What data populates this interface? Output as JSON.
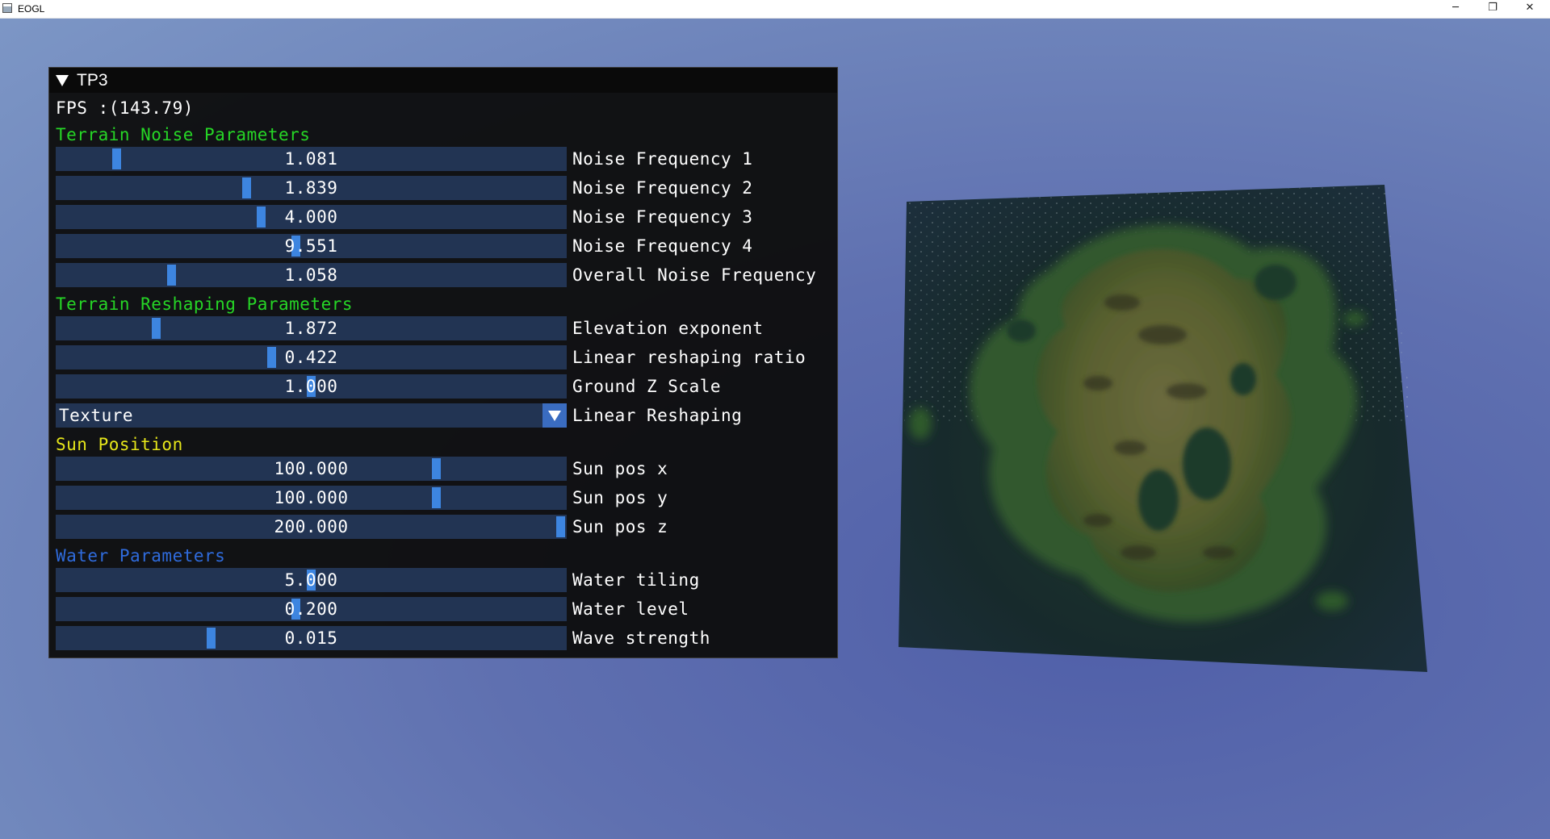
{
  "window": {
    "title": "EOGL",
    "minimize_glyph": "─",
    "maximize_glyph": "❐",
    "close_glyph": "✕"
  },
  "panel": {
    "title": "TP3",
    "fps_text": "FPS :(143.79)",
    "sections": {
      "terrain_noise": "Terrain Noise Parameters",
      "terrain_reshaping": "Terrain Reshaping Parameters",
      "sun_position": "Sun Position",
      "water": "Water Parameters"
    },
    "section_colors": {
      "terrain_noise": "#26d626",
      "terrain_reshaping": "#26d626",
      "sun_position": "#e6e61a",
      "water": "#2f6bdc"
    },
    "sliders": [
      {
        "label": "Noise Frequency 1",
        "value": "1.081",
        "fraction": 0.11
      },
      {
        "label": "Noise Frequency 2",
        "value": "1.839",
        "fraction": 0.37
      },
      {
        "label": "Noise Frequency 3",
        "value": "4.000",
        "fraction": 0.4
      },
      {
        "label": "Noise Frequency 4",
        "value": "9.551",
        "fraction": 0.47
      },
      {
        "label": "Overall Noise Frequency",
        "value": "1.058",
        "fraction": 0.22
      },
      {
        "label": "Elevation exponent",
        "value": "1.872",
        "fraction": 0.19
      },
      {
        "label": "Linear reshaping ratio",
        "value": "0.422",
        "fraction": 0.42
      },
      {
        "label": "Ground Z Scale",
        "value": "1.000",
        "fraction": 0.5
      },
      {
        "label": "Sun pos x",
        "value": "100.000",
        "fraction": 0.75
      },
      {
        "label": "Sun pos y",
        "value": "100.000",
        "fraction": 0.75
      },
      {
        "label": "Sun pos z",
        "value": "200.000",
        "fraction": 1.0
      },
      {
        "label": "Water tiling",
        "value": "5.000",
        "fraction": 0.5
      },
      {
        "label": "Water level",
        "value": "0.200",
        "fraction": 0.47
      },
      {
        "label": "Wave strength",
        "value": "0.015",
        "fraction": 0.3
      }
    ],
    "combo": {
      "selected": "Texture",
      "label": "Linear Reshaping"
    },
    "colors": {
      "slider_bg": "#223453",
      "grab": "#3d85e0",
      "panel_bg": "#0e0e0e"
    }
  },
  "viewport": {
    "object": "procedural terrain island on water plane",
    "icon": "terrain-render"
  }
}
